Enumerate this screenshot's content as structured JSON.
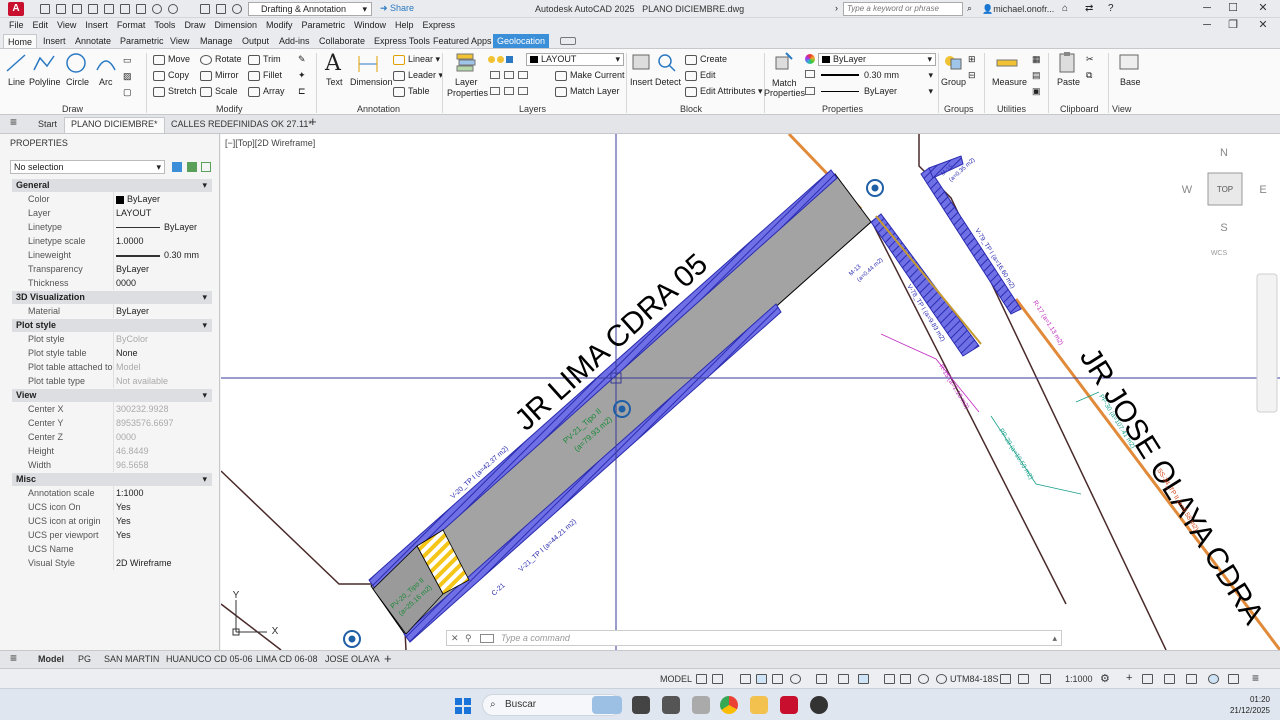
{
  "titlebar": {
    "workspace": "Drafting & Annotation",
    "share": "Share",
    "app_title": "Autodesk AutoCAD 2025",
    "file_name": "PLANO DICIEMBRE.dwg",
    "search_placeholder": "Type a keyword or phrase",
    "user": "michael.onofr...",
    "app_logo": "A"
  },
  "menu": [
    "File",
    "Edit",
    "View",
    "Insert",
    "Format",
    "Tools",
    "Draw",
    "Dimension",
    "Modify",
    "Parametric",
    "Window",
    "Help",
    "Express"
  ],
  "ribbon_tabs": [
    "Home",
    "Insert",
    "Annotate",
    "Parametric",
    "View",
    "Manage",
    "Output",
    "Add-ins",
    "Collaborate",
    "Express Tools",
    "Featured Apps",
    "Geolocation"
  ],
  "ribbon": {
    "draw": {
      "line": "Line",
      "polyline": "Polyline",
      "circle": "Circle",
      "arc": "Arc",
      "title": "Draw"
    },
    "modify": {
      "move": "Move",
      "rotate": "Rotate",
      "trim": "Trim",
      "copy": "Copy",
      "mirror": "Mirror",
      "fillet": "Fillet",
      "stretch": "Stretch",
      "scale": "Scale",
      "array": "Array",
      "title": "Modify"
    },
    "annotation": {
      "text": "Text",
      "dimension": "Dimension",
      "linear": "Linear",
      "leader": "Leader",
      "table": "Table",
      "title": "Annotation"
    },
    "layers": {
      "layer_properties_1": "Layer",
      "layer_properties_2": "Properties",
      "current": "LAYOUT",
      "make_current": "Make Current",
      "match_layer": "Match Layer",
      "title": "Layers"
    },
    "block": {
      "insert": "Insert",
      "detect": "Detect",
      "create": "Create",
      "edit": "Edit",
      "edit_attributes": "Edit Attributes",
      "title": "Block"
    },
    "properties": {
      "match_1": "Match",
      "match_2": "Properties",
      "color": "ByLayer",
      "lineweight": "0.30 mm",
      "linetype": "ByLayer",
      "title": "Properties"
    },
    "groups": {
      "group": "Group",
      "title": "Groups"
    },
    "utilities": {
      "measure": "Measure",
      "title": "Utilities"
    },
    "clipboard": {
      "paste": "Paste",
      "title": "Clipboard"
    },
    "view": {
      "base": "Base",
      "title": "View"
    }
  },
  "doc_tabs": [
    "Start",
    "PLANO DICIEMBRE*",
    "CALLES REDEFINIDAS OK 27.11*"
  ],
  "properties_panel": {
    "title": "PROPERTIES",
    "selection": "No selection",
    "sections": [
      {
        "name": "General",
        "rows": [
          [
            "Color",
            "ByLayer"
          ],
          [
            "Layer",
            "LAYOUT"
          ],
          [
            "Linetype",
            "ByLayer"
          ],
          [
            "Linetype scale",
            "1.0000"
          ],
          [
            "Lineweight",
            "0.30 mm"
          ],
          [
            "Transparency",
            "ByLayer"
          ],
          [
            "Thickness",
            "0000"
          ]
        ]
      },
      {
        "name": "3D Visualization",
        "rows": [
          [
            "Material",
            "ByLayer"
          ]
        ]
      },
      {
        "name": "Plot style",
        "rows": [
          [
            "Plot style",
            "ByColor"
          ],
          [
            "Plot style table",
            "None"
          ],
          [
            "Plot table attached to",
            "Model"
          ],
          [
            "Plot table type",
            "Not available"
          ]
        ]
      },
      {
        "name": "View",
        "rows": [
          [
            "Center X",
            "300232.9928"
          ],
          [
            "Center Y",
            "8953576.6697"
          ],
          [
            "Center Z",
            "0000"
          ],
          [
            "Height",
            "46.8449"
          ],
          [
            "Width",
            "96.5658"
          ]
        ]
      },
      {
        "name": "Misc",
        "rows": [
          [
            "Annotation scale",
            "1:1000"
          ],
          [
            "UCS icon On",
            "Yes"
          ],
          [
            "UCS icon at origin",
            "Yes"
          ],
          [
            "UCS per viewport",
            "Yes"
          ],
          [
            "UCS Name",
            ""
          ],
          [
            "Visual Style",
            "2D Wireframe"
          ]
        ]
      }
    ]
  },
  "canvas": {
    "view_label": "[−][Top][2D Wireframe]",
    "street_1": "JR LIMA CDRA 05",
    "street_2": "JR JOSE OLAYA CDRA",
    "labels": {
      "v20": "V-20_TP I (a=42.37 m2)",
      "v21": "V-21_TP I (a=44.21 m2)",
      "pv21": "PV-21_Tipo II",
      "pv21b": "(a=79.93 m2)",
      "pv20": "PV-20_Tipo II",
      "pv20b": "(a=25.16 m2)",
      "c21": "C-21",
      "m13": "M-13",
      "m13b": "(a=0.44 m2)",
      "m15": "M-15",
      "m15b": "(a=0.35 m2)",
      "v78": "V-78_TP I (a=9.83 m2)",
      "v79": "V-79_TP I (a=16.60 m2)",
      "r15": "R-15 (a=1.13 m2)",
      "r17": "R-17 (a=1.13 m2)",
      "pp29": "PP-29 (a=10.53 m2)",
      "pp30": "PP-30 (a=107.41 m2)",
      "ss34": "SS-34_TP II (a=6.58 m2)"
    },
    "viewcube": {
      "n": "N",
      "s": "S",
      "e": "E",
      "w": "W",
      "top": "TOP",
      "wcs": "WCS"
    },
    "ucs": {
      "x": "X",
      "y": "Y"
    },
    "command_placeholder": "Type a command"
  },
  "layout_tabs": [
    "Model",
    "PG",
    "SAN MARTIN",
    "HUANUCO CD 05-06",
    "LIMA CD 06-08",
    "JOSE OLAYA"
  ],
  "status": {
    "model": "MODEL",
    "coords": "UTM84-18S",
    "scale": "1:1000"
  },
  "taskbar": {
    "search": "Buscar",
    "time": "01:20",
    "date": "21/12/2025"
  },
  "colors": {
    "accent": "#3b8ed8",
    "autocad_red": "#c8102e",
    "hatch_blue": "#4b4ee0",
    "road_gray": "#a3a3a3",
    "orange": "#e08a3a"
  }
}
